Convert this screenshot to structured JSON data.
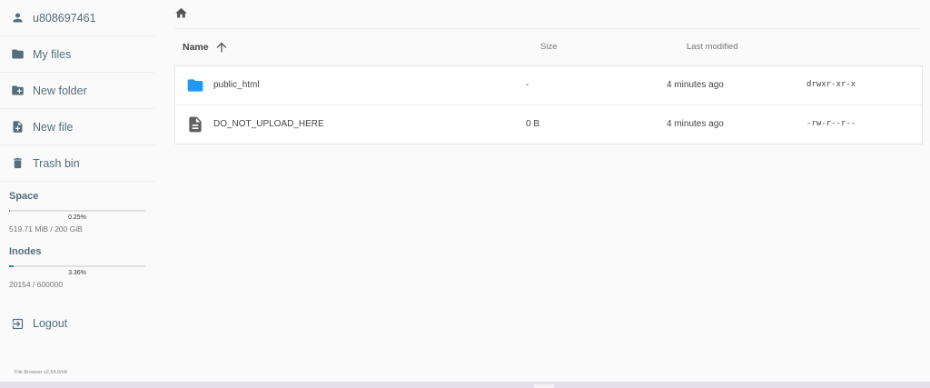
{
  "sidebar": {
    "user": {
      "label": "u808697461",
      "icon": "account-icon"
    },
    "items": [
      {
        "label": "My files",
        "icon": "folder-icon"
      },
      {
        "label": "New folder",
        "icon": "create-new-folder-icon"
      },
      {
        "label": "New file",
        "icon": "note-add-icon"
      },
      {
        "label": "Trash bin",
        "icon": "trash-icon"
      }
    ],
    "space": {
      "title": "Space",
      "percent_label": "0.25%",
      "percent": 0.25,
      "value": "519.71 MiB / 200 GiB"
    },
    "inodes": {
      "title": "Inodes",
      "percent_label": "3.36%",
      "percent": 3.36,
      "value": "20154 / 600000"
    },
    "logout": {
      "label": "Logout",
      "icon": "logout-icon"
    },
    "version": "File Browser v2.54.0/n8"
  },
  "breadcrumb": {
    "icon": "home-icon"
  },
  "table": {
    "headers": {
      "name": "Name",
      "size": "Size",
      "modified": "Last modified"
    },
    "sort": {
      "icon": "arrow-upward-icon"
    },
    "rows": [
      {
        "icon": "folder-icon",
        "name": "public_html",
        "size": "-",
        "modified": "4 minutes ago",
        "permissions": "drwxr-xr-x"
      },
      {
        "icon": "file-icon",
        "name": "DO_NOT_UPLOAD_HERE",
        "size": "0 B",
        "modified": "4 minutes ago",
        "permissions": "-rw-r--r--"
      }
    ]
  },
  "colors": {
    "accent": "#2196f3",
    "folder": "#2196f3",
    "sidebar_text": "#546e7a",
    "inodes_bar": "#2f7f9a"
  }
}
